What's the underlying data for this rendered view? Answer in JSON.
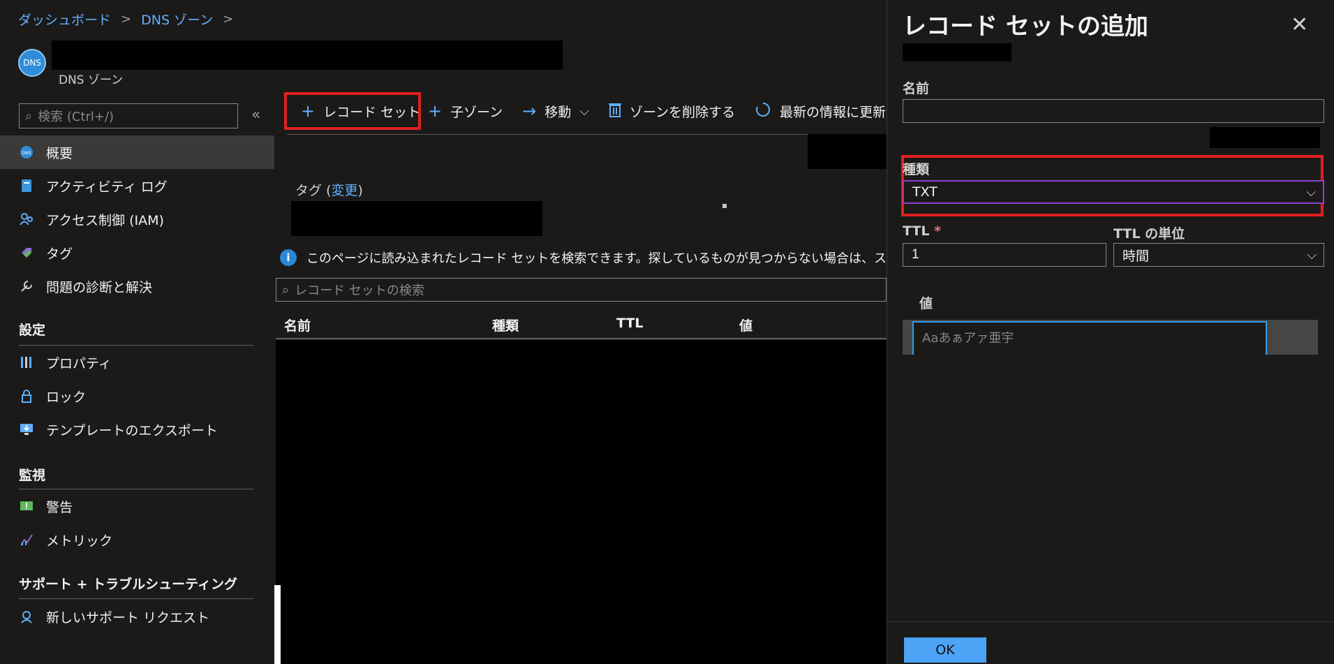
{
  "breadcrumb": {
    "items": [
      "ダッシュボード",
      "DNS ゾーン"
    ],
    "separator": ">"
  },
  "resource": {
    "logo_text": "DNS",
    "type": "DNS ゾーン"
  },
  "sidebar": {
    "search_placeholder": "検索 (Ctrl+/)",
    "collapse": "«",
    "items": [
      {
        "label": "概要",
        "icon": "dns-zone-icon"
      },
      {
        "label": "アクティビティ ログ",
        "icon": "activity-log-icon"
      },
      {
        "label": "アクセス制御 (IAM)",
        "icon": "iam-icon"
      },
      {
        "label": "タグ",
        "icon": "tag-icon"
      },
      {
        "label": "問題の診断と解決",
        "icon": "wrench-icon"
      }
    ],
    "sections": [
      {
        "title": "設定",
        "items": [
          {
            "label": "プロパティ",
            "icon": "properties-icon"
          },
          {
            "label": "ロック",
            "icon": "lock-icon"
          },
          {
            "label": "テンプレートのエクスポート",
            "icon": "export-template-icon"
          }
        ]
      },
      {
        "title": "監視",
        "items": [
          {
            "label": "警告",
            "icon": "alert-icon"
          },
          {
            "label": "メトリック",
            "icon": "metrics-icon"
          }
        ]
      },
      {
        "title": "サポート + トラブルシューティング",
        "items": [
          {
            "label": "新しいサポート リクエスト",
            "icon": "support-icon"
          }
        ]
      }
    ]
  },
  "toolbar": {
    "record_set": "レコード セット",
    "child_zone": "子ゾーン",
    "move": "移動",
    "delete_zone": "ゾーンを削除する",
    "refresh": "最新の情報に更新"
  },
  "tags": {
    "label": "タグ",
    "open": "(",
    "link": "変更",
    "close": ")"
  },
  "info_text": "このページに読み込まれたレコード セットを検索できます。探しているものが見つからない場合は、スクロールしてそ",
  "record_search_placeholder": "レコード セットの検索",
  "table": {
    "headers": [
      "名前",
      "種類",
      "TTL",
      "値"
    ]
  },
  "panel": {
    "title": "レコード セットの追加",
    "name_label": "名前",
    "name_value": "",
    "type_label": "種類",
    "type_value": "TXT",
    "ttl_label": "TTL",
    "ttl_required": "*",
    "ttl_value": "1",
    "ttl_unit_label": "TTL の単位",
    "ttl_unit_value": "時間",
    "value_label": "値",
    "value_placeholder": "Aaあぁアァ亜宇",
    "ok_label": "OK"
  },
  "colors": {
    "accent": "#5fb0ff",
    "highlight": "#e02020",
    "ok_button": "#4da3f5"
  }
}
